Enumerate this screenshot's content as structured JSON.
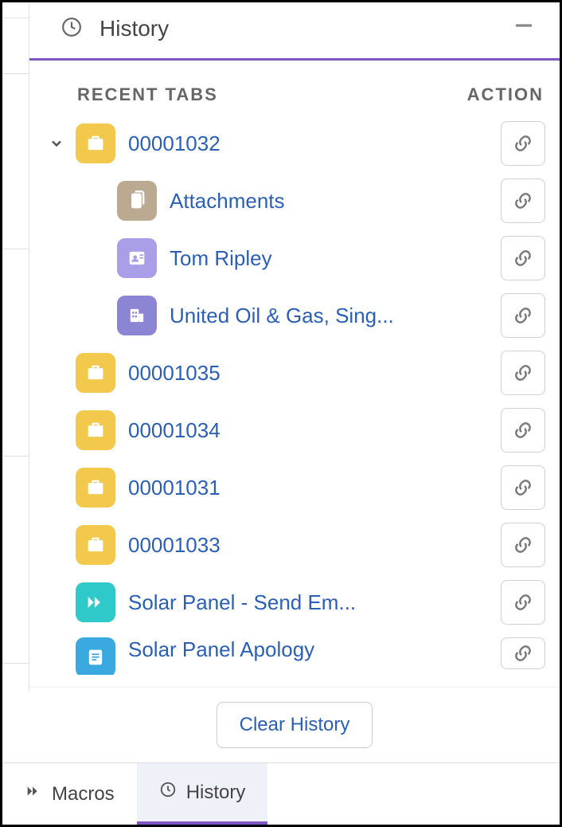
{
  "panel": {
    "title": "History",
    "columns": {
      "recent": "RECENT TABS",
      "action": "ACTION"
    },
    "clear_label": "Clear History"
  },
  "items": [
    {
      "label": "00001032",
      "icon": "case",
      "expanded": true,
      "children": [
        {
          "label": "Attachments",
          "icon": "attach"
        },
        {
          "label": "Tom Ripley",
          "icon": "contact"
        },
        {
          "label": "United Oil & Gas, Sing...",
          "icon": "account"
        }
      ]
    },
    {
      "label": "00001035",
      "icon": "case"
    },
    {
      "label": "00001034",
      "icon": "case"
    },
    {
      "label": "00001031",
      "icon": "case"
    },
    {
      "label": "00001033",
      "icon": "case"
    },
    {
      "label": "Solar Panel - Send Em...",
      "icon": "macro"
    },
    {
      "label": "Solar Panel Apology",
      "icon": "doc"
    }
  ],
  "tabs": {
    "macros": "Macros",
    "history": "History"
  }
}
